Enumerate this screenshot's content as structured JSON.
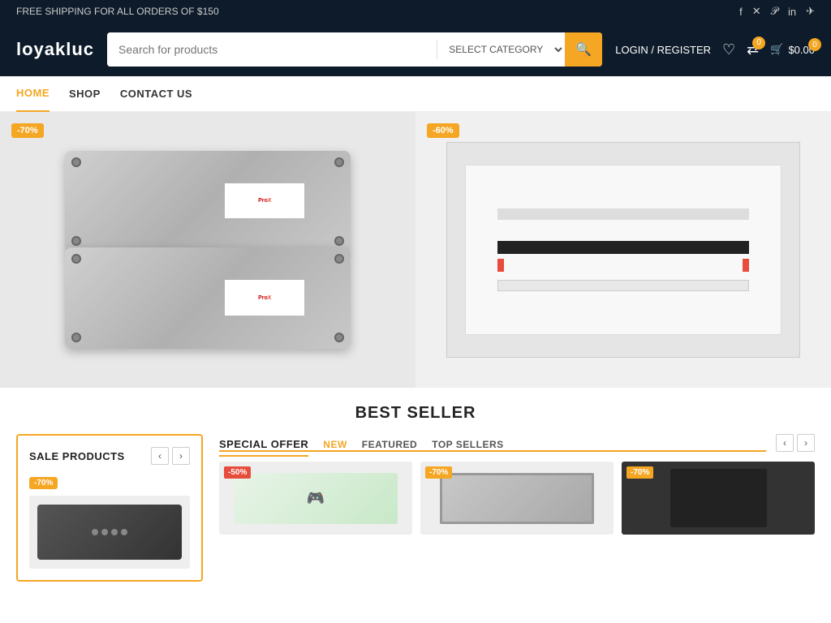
{
  "topbar": {
    "shipping_text": "FREE SHIPPING FOR ALL ORDERS OF $150",
    "social_icons": [
      "facebook",
      "twitter-x",
      "pinterest",
      "linkedin",
      "telegram"
    ]
  },
  "header": {
    "logo": "loyakluc",
    "search_placeholder": "Search for products",
    "category_label": "SELECT CATEGORY",
    "search_btn_icon": "🔍",
    "login_label": "LOGIN / REGISTER",
    "wishlist_count": "",
    "compare_count": "0",
    "cart_count": "0",
    "cart_amount": "$0.00"
  },
  "nav": {
    "items": [
      {
        "label": "HOME",
        "active": true
      },
      {
        "label": "SHOP",
        "active": false
      },
      {
        "label": "CONTACT US",
        "active": false
      }
    ]
  },
  "hero": {
    "left_badge": "-70%",
    "right_badge": "-60%"
  },
  "best_seller": {
    "title": "BEST SELLER"
  },
  "sale_products": {
    "title": "SALE PRODUCTS",
    "badge": "-70%",
    "prev_label": "‹",
    "next_label": "›"
  },
  "special_offer": {
    "title": "SPECIAL OFFER",
    "tabs": [
      {
        "label": "NEW",
        "active": true
      },
      {
        "label": "FEATURED",
        "active": false
      },
      {
        "label": "TOP SELLERS",
        "active": false
      }
    ],
    "products": [
      {
        "badge": "-50%",
        "badge_color": "red"
      },
      {
        "badge": "-70%",
        "badge_color": "orange"
      },
      {
        "badge": "-70%",
        "badge_color": "orange"
      }
    ],
    "prev_label": "‹",
    "next_label": "›"
  }
}
